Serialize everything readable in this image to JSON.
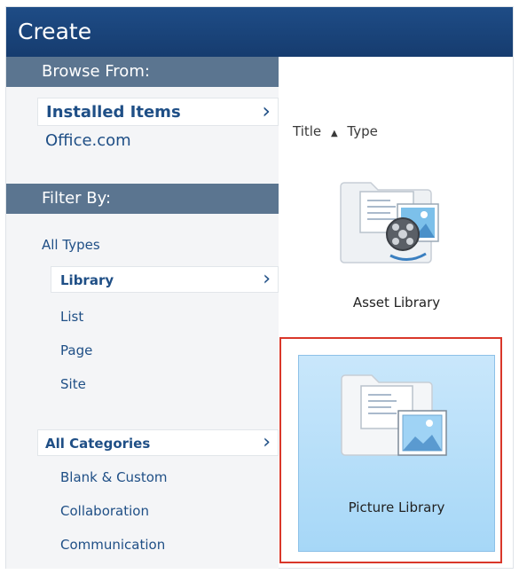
{
  "window": {
    "title": "Create"
  },
  "browse": {
    "header": "Browse From:",
    "items": [
      {
        "label": "Installed Items",
        "selected": true
      },
      {
        "label": "Office.com",
        "selected": false
      }
    ]
  },
  "filter": {
    "header": "Filter By:",
    "types": [
      {
        "label": "All Types",
        "selected": false
      },
      {
        "label": "Library",
        "selected": true
      },
      {
        "label": "List",
        "selected": false
      },
      {
        "label": "Page",
        "selected": false
      },
      {
        "label": "Site",
        "selected": false
      }
    ],
    "categories": [
      {
        "label": "All Categories",
        "selected": true
      },
      {
        "label": "Blank & Custom",
        "selected": false
      },
      {
        "label": "Collaboration",
        "selected": false
      },
      {
        "label": "Communication",
        "selected": false
      }
    ]
  },
  "sort": {
    "title_label": "Title",
    "title_arrow": "▲",
    "type_label": "Type"
  },
  "chevron": "›",
  "tiles": [
    {
      "label": "Asset Library",
      "icon": "asset-library-icon",
      "selected": false
    },
    {
      "label": "Picture Library",
      "icon": "picture-library-icon",
      "selected": true
    }
  ],
  "colors": {
    "titlebar": "#1b467c",
    "section_header": "#5b7590",
    "link": "#1f4f86",
    "selected_tile": "#b7dff9",
    "highlight_border": "#d9372a"
  }
}
